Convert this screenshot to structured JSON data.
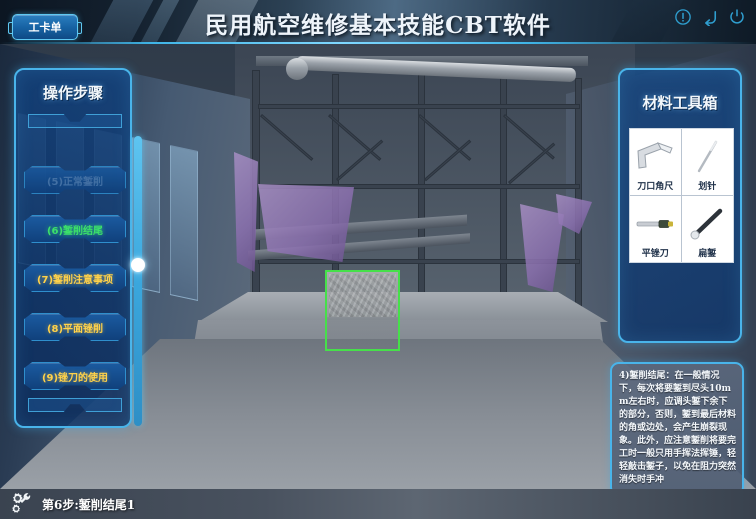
{
  "topbar": {
    "title": "民用航空维修基本技能CBT软件",
    "workcard_button": "工卡单",
    "icons": [
      {
        "name": "info-icon",
        "label": "!"
      },
      {
        "name": "reset-icon",
        "label": "reset"
      },
      {
        "name": "power-icon",
        "label": "power"
      }
    ]
  },
  "left_panel": {
    "title": "操作步骤",
    "steps": [
      {
        "label": "(5)正常錾削",
        "state": "dim"
      },
      {
        "label": "(6)錾削结尾",
        "state": "active"
      },
      {
        "label": "(7)錾削注意事项",
        "state": "warn"
      },
      {
        "label": "(8)平面锉削",
        "state": "warn"
      },
      {
        "label": "(9)锉刀的使用",
        "state": "warn"
      }
    ],
    "scroll_position_percent": 42
  },
  "right_panel": {
    "title": "材料工具箱",
    "tools": [
      {
        "label": "刀口角尺",
        "icon": "knife-edge-square-icon"
      },
      {
        "label": "划针",
        "icon": "scriber-icon"
      },
      {
        "label": "平锉刀",
        "icon": "flat-file-icon"
      },
      {
        "label": "扁錾",
        "icon": "flat-chisel-icon"
      }
    ]
  },
  "info_panel": {
    "text": "4)錾削结尾：在一般情况下，每次将要錾到尽头10mm左右时，应调头錾下余下的部分，否则，錾到最后材料的角或边处，会产生崩裂现象。此外，应注意錾削将要完工时一般只用手挥法挥锤，轻轻敲击錾子，以免在阻力突然消失时手冲"
  },
  "statusbar": {
    "step_text": "第6步:錾削结尾1",
    "icon": "gears-wrench-icon"
  },
  "scene": {
    "selection_label": "workpiece-selection-box"
  },
  "colors": {
    "accent_cyan": "#49b4ea",
    "panel_blue": "#12407a",
    "active_green": "#3ce06a",
    "warn_yellow": "#ffd24a",
    "selection_green": "#46e04a"
  }
}
